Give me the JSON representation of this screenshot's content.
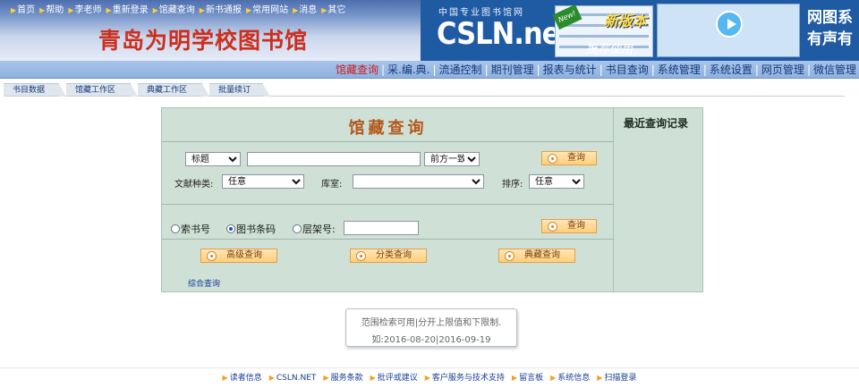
{
  "header": {
    "top_nav": [
      "首页",
      "帮助",
      "李老师",
      "重新登录",
      "馆藏查询",
      "新书通报",
      "常用网站",
      "消息",
      "其它"
    ],
    "library_name": "青岛为明学校图书馆",
    "ad": {
      "small_text": "中国专业图书馆网",
      "brand": "CSLN.net",
      "new_badge": "New!",
      "new_version": "新版本",
      "recommend": "推荐使用",
      "right_line1": "网图系",
      "right_line2": "有声有"
    }
  },
  "main_nav": {
    "items": [
      "馆藏查询",
      "采.编.典.",
      "流通控制",
      "期刊管理",
      "报表与统计",
      "书目查询",
      "系统管理",
      "系统设置",
      "网页管理",
      "微信管理"
    ],
    "active_index": 0
  },
  "sub_tabs": [
    "书目数据",
    "馆藏工作区",
    "典藏工作区",
    "批量续订"
  ],
  "search": {
    "title": "馆藏查询",
    "field_select": "标题",
    "keyword_value": "",
    "match_select": "前方一致",
    "query_button": "查询",
    "doc_type_label": "文献种类:",
    "doc_type_value": "任意",
    "location_label": "库室:",
    "location_value": "",
    "sort_label": "排序:",
    "sort_value": "任意",
    "radios": [
      {
        "label": "索书号",
        "checked": false
      },
      {
        "label": "图书条码",
        "checked": true
      },
      {
        "label": "层架号:",
        "checked": false
      }
    ],
    "shelf_value": "",
    "query_button2": "查询",
    "advanced_button": "高级查询",
    "category_button": "分类查询",
    "collection_button": "典藏查询",
    "combined_link": "综合查询",
    "recent_title": "最近查询记录"
  },
  "hint": {
    "line1": "范围检索可用|分开上限值和下限制.",
    "line2": "如:2016-08-20|2016-09-19"
  },
  "footer": [
    "读者信息",
    "CSLN.NET",
    "服务条款",
    "批评或建议",
    "客户服务与技术支持",
    "留言板",
    "系统信息",
    "扫描登录"
  ],
  "colors": {
    "title_red": "#cc2f1d",
    "nav_active": "#d11a1a",
    "panel_bg": "#cfe0d6",
    "panel_title": "#b2581c",
    "button_orange": "#ffcf7a"
  }
}
